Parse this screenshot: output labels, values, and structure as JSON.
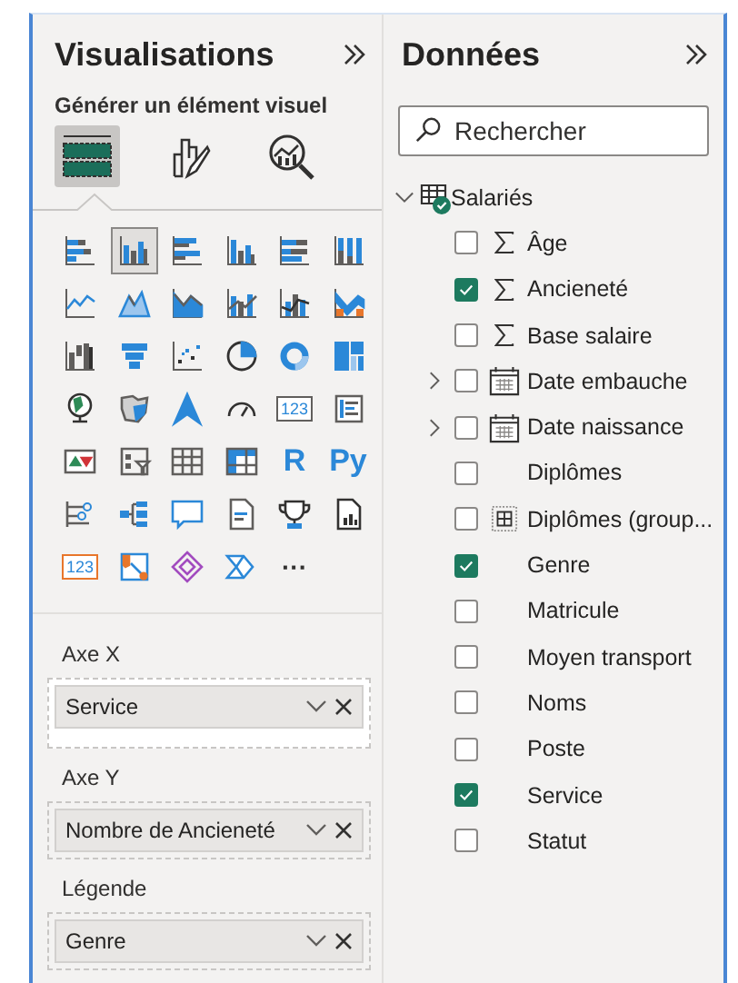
{
  "visual_pane": {
    "title": "Visualisations",
    "subtitle": "Générer un élément visuel",
    "tabs": [
      {
        "kind": "build",
        "selected": true
      },
      {
        "kind": "format",
        "selected": false
      },
      {
        "kind": "analytics",
        "selected": false
      }
    ],
    "visuals": [
      {
        "kind": "stacked-bar",
        "selected": false
      },
      {
        "kind": "clustered-column",
        "selected": true
      },
      {
        "kind": "clustered-bar",
        "selected": false
      },
      {
        "kind": "stacked-column",
        "selected": false
      },
      {
        "kind": "bar-100",
        "selected": false
      },
      {
        "kind": "column-100",
        "selected": false
      },
      {
        "kind": "line",
        "selected": false
      },
      {
        "kind": "area",
        "selected": false
      },
      {
        "kind": "stacked-area",
        "selected": false
      },
      {
        "kind": "line-column",
        "selected": false
      },
      {
        "kind": "line-clustered",
        "selected": false
      },
      {
        "kind": "ribbon",
        "selected": false
      },
      {
        "kind": "waterfall",
        "selected": false
      },
      {
        "kind": "funnel",
        "selected": false
      },
      {
        "kind": "scatter",
        "selected": false
      },
      {
        "kind": "pie",
        "selected": false
      },
      {
        "kind": "donut",
        "selected": false
      },
      {
        "kind": "treemap",
        "selected": false
      },
      {
        "kind": "globe",
        "selected": false
      },
      {
        "kind": "filled-map",
        "selected": false
      },
      {
        "kind": "navigation",
        "selected": false
      },
      {
        "kind": "gauge",
        "selected": false
      },
      {
        "kind": "card",
        "label": "123",
        "selected": false
      },
      {
        "kind": "multi-card",
        "selected": false
      },
      {
        "kind": "kpi",
        "selected": false
      },
      {
        "kind": "slicer",
        "selected": false
      },
      {
        "kind": "table",
        "selected": false
      },
      {
        "kind": "matrix",
        "selected": false
      },
      {
        "kind": "letter",
        "label": "R",
        "selected": false
      },
      {
        "kind": "letter",
        "label": "Py",
        "selected": false
      },
      {
        "kind": "influencers",
        "selected": false
      },
      {
        "kind": "decomposition",
        "selected": false
      },
      {
        "kind": "speech",
        "selected": false
      },
      {
        "kind": "narrative",
        "selected": false
      },
      {
        "kind": "trophy",
        "selected": false
      },
      {
        "kind": "paginated",
        "selected": false
      },
      {
        "kind": "flash-card",
        "label": "123",
        "selected": false
      },
      {
        "kind": "workflow",
        "selected": false
      },
      {
        "kind": "diamond",
        "selected": false
      },
      {
        "kind": "chevron",
        "selected": false
      },
      {
        "kind": "more",
        "label": "···",
        "selected": false
      }
    ],
    "wells": [
      {
        "label": "Axe X",
        "value": "Service"
      },
      {
        "label": "Axe Y",
        "value": "Nombre de Ancieneté"
      },
      {
        "label": "Légende",
        "value": "Genre"
      }
    ]
  },
  "data_pane": {
    "title": "Données",
    "search": {
      "placeholder": "Rechercher"
    },
    "table": {
      "name": "Salariés",
      "expanded": true,
      "in_use": true,
      "fields": [
        {
          "name": "Âge",
          "kind": "sum",
          "checked": false
        },
        {
          "name": "Ancieneté",
          "kind": "sum",
          "checked": true
        },
        {
          "name": "Base salaire",
          "kind": "sum",
          "checked": false
        },
        {
          "name": "Date embauche",
          "kind": "date",
          "expanded": false,
          "checked": false
        },
        {
          "name": "Date naissance",
          "kind": "date",
          "expanded": false,
          "checked": false
        },
        {
          "name": "Diplômes",
          "kind": "plain",
          "checked": false
        },
        {
          "name": "Diplômes (group...",
          "kind": "group",
          "checked": false
        },
        {
          "name": "Genre",
          "kind": "plain",
          "checked": true
        },
        {
          "name": "Matricule",
          "kind": "plain",
          "checked": false
        },
        {
          "name": "Moyen transport",
          "kind": "plain",
          "checked": false
        },
        {
          "name": "Noms",
          "kind": "plain",
          "checked": false
        },
        {
          "name": "Poste",
          "kind": "plain",
          "checked": false
        },
        {
          "name": "Service",
          "kind": "plain",
          "checked": true
        },
        {
          "name": "Statut",
          "kind": "plain",
          "checked": false
        }
      ]
    }
  }
}
